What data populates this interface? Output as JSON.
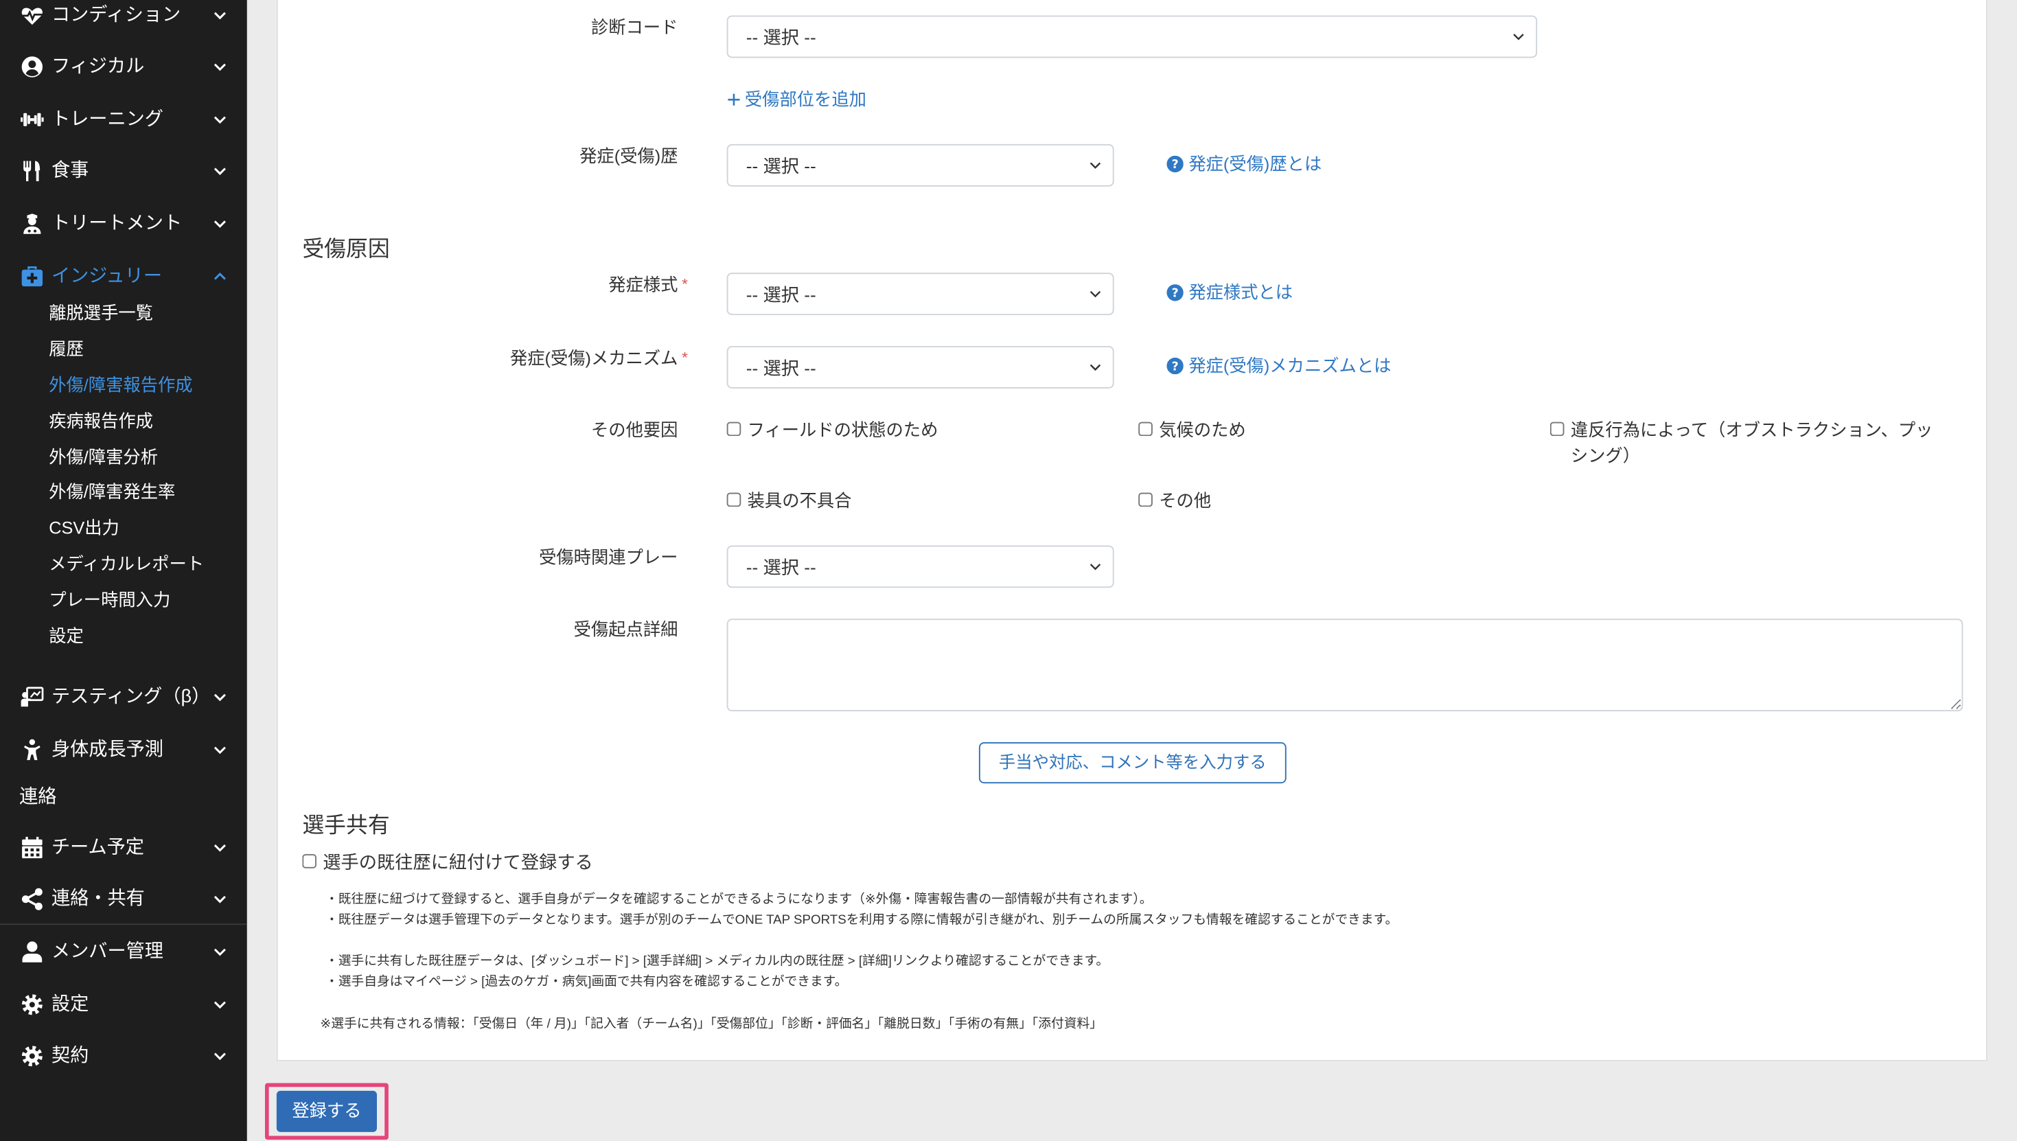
{
  "sidebar": {
    "top_items": [
      {
        "label": "コンディション",
        "icon": "heart-pulse-icon"
      },
      {
        "label": "フィジカル",
        "icon": "user-circle-icon"
      },
      {
        "label": "トレーニング",
        "icon": "dumbbell-icon"
      },
      {
        "label": "食事",
        "icon": "utensils-icon"
      },
      {
        "label": "トリートメント",
        "icon": "user-nurse-icon"
      }
    ],
    "active_item": {
      "label": "インジュリー",
      "icon": "medkit-icon",
      "expanded": true
    },
    "sub_items": [
      "離脱選手一覧",
      "履歴",
      "外傷/障害報告作成",
      "疾病報告作成",
      "外傷/障害分析",
      "外傷/障害発生率",
      "CSV出力",
      "メディカルレポート",
      "プレー時間入力",
      "設定"
    ],
    "active_sub_index": 2,
    "bottom_items": [
      {
        "label": "テスティング（β）",
        "icon": "chalkboard-teacher-icon"
      },
      {
        "label": "身体成長予測",
        "icon": "child-icon"
      },
      {
        "label": "連絡",
        "icon": ""
      },
      {
        "label": "チーム予定",
        "icon": "calendar-icon"
      },
      {
        "label": "連絡・共有",
        "icon": "share-icon"
      },
      {
        "label": "メンバー管理",
        "icon": "user-icon"
      },
      {
        "label": "設定",
        "icon": "gear-icon"
      },
      {
        "label": "契約",
        "icon": "gear-icon"
      }
    ]
  },
  "form": {
    "diagnosis_code": {
      "label": "診断コード",
      "value": "-- 選択 --"
    },
    "add_injury_site": {
      "label": "受傷部位を追加",
      "icon": "plus-icon"
    },
    "history": {
      "label": "発症(受傷)歴",
      "value": "-- 選択 --",
      "help": "発症(受傷)歴とは"
    },
    "cause_heading": "受傷原因",
    "onset_mode": {
      "label": "発症様式",
      "required": "*",
      "value": "-- 選択 --",
      "help": "発症様式とは"
    },
    "mechanism": {
      "label": "発症(受傷)メカニズム",
      "required": "*",
      "value": "-- 選択 --",
      "help": "発症(受傷)メカニズムとは"
    },
    "other_factors": {
      "label": "その他要因",
      "options": [
        {
          "label": "フィールドの状態のため",
          "checked": false
        },
        {
          "label": "気候のため",
          "checked": false
        },
        {
          "label": "違反行為によって（オブストラクション、プッシング）",
          "checked": false
        },
        {
          "label": "装具の不具合",
          "checked": false
        },
        {
          "label": "その他",
          "checked": false
        }
      ]
    },
    "related_play": {
      "label": "受傷時関連プレー",
      "value": "-- 選択 --"
    },
    "detail": {
      "label": "受傷起点詳細",
      "value": ""
    },
    "comment_button": "手当や対応、コメント等を入力する",
    "share_heading": "選手共有",
    "share_checkbox": {
      "label": "選手の既往歴に紐付けて登録する",
      "checked": false
    },
    "notes": [
      "・既往歴に紐づけて登録すると、選手自身がデータを確認することができるようになります（※外傷・障害報告書の一部情報が共有されます）。",
      "・既往歴データは選手管理下のデータとなります。選手が別のチームでONE TAP SPORTSを利用する際に情報が引き継がれ、別チームの所属スタッフも情報を確認することができます。",
      "・選手に共有した既往歴データは、[ダッシュボード] > [選手詳細] > メディカル内の既往歴 > [詳細]リンクより確認することができます。",
      "・選手自身はマイページ > [過去のケガ・病気]画面で共有内容を確認することができます。"
    ],
    "shared_info_note": "※選手に共有される情報：「受傷日（年 / 月)」「記入者（チーム名)」「受傷部位」「診断・評価名」「離脱日数」「手術の有無」「添付資料」"
  },
  "submit_button": "登録する",
  "colors": {
    "sidebar_bg": "#1e1e1e",
    "page_bg": "#ebebeb",
    "active_nav": "#3e92e3",
    "link": "#2f78c4",
    "primary_button": "#2f6cb5",
    "required_mark": "#d9534f",
    "highlight_box": "#e4457b"
  }
}
